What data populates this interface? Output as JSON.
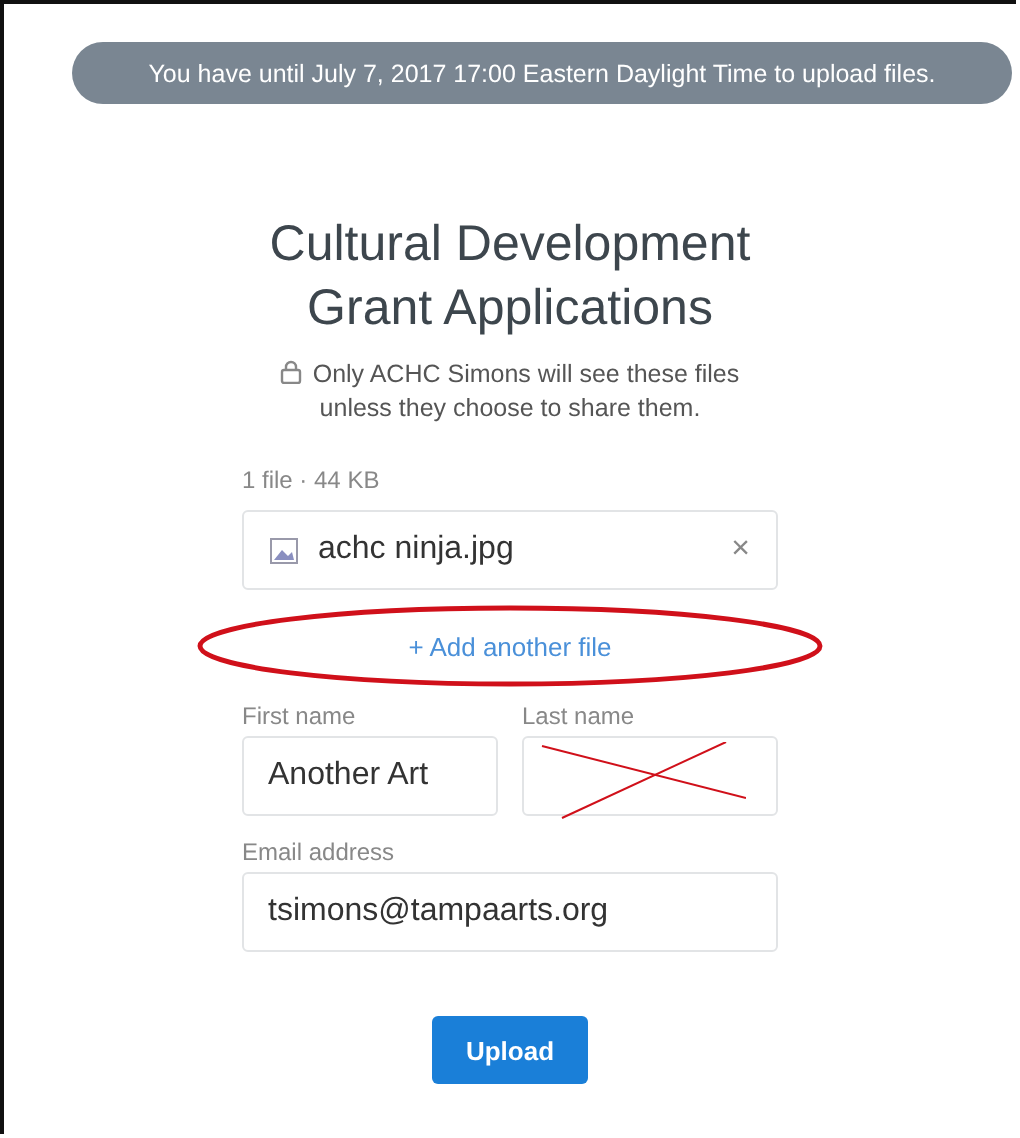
{
  "banner": "You have until July 7, 2017 17:00 Eastern Daylight Time to upload files.",
  "title": "Cultural Development Grant Applications",
  "privacy_note": "Only ACHC Simons will see these files unless they choose to share them.",
  "file_summary": "1 file · 44 KB",
  "files": [
    {
      "name": "achc ninja.jpg",
      "remove": "×"
    }
  ],
  "add_file_link": "+ Add another file",
  "fields": [
    {
      "label": "First name",
      "value": "Another Art",
      "kind": "half"
    },
    {
      "label": "Last name",
      "kind": "half",
      "crossed_out": true
    },
    {
      "label": "Email address",
      "value": "tsimons@tampaarts.org",
      "kind": "full"
    }
  ],
  "upload_button": "Upload"
}
